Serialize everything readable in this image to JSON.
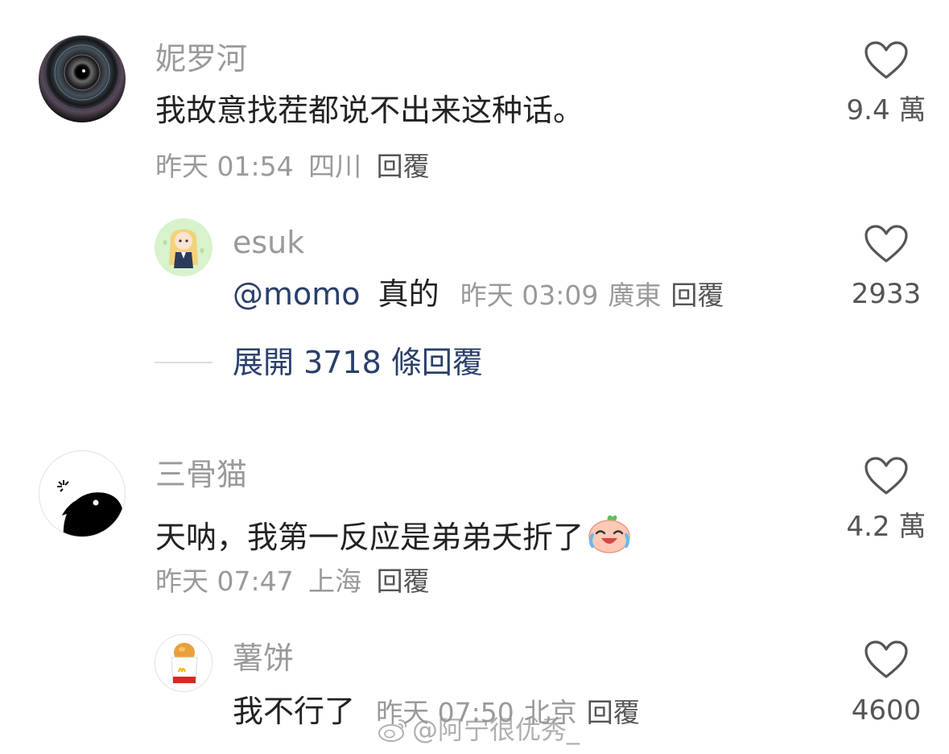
{
  "comments": [
    {
      "username": "妮罗河",
      "text": "我故意找茬都说不出来这种话。",
      "time": "昨天 01:54",
      "location": "四川",
      "reply_label": "回覆",
      "likes": "9.4 萬",
      "replies": [
        {
          "username": "esuk",
          "mention": "@momo",
          "text": "真的",
          "time": "昨天 03:09",
          "location": "廣東",
          "reply_label": "回覆",
          "likes": "2933"
        }
      ],
      "expand_label": "展開 3718 條回覆"
    },
    {
      "username": "三骨猫",
      "text": "天呐，我第一反应是弟弟夭折了",
      "time": "昨天 07:47",
      "location": "上海",
      "reply_label": "回覆",
      "likes": "4.2 萬",
      "replies": [
        {
          "username": "薯饼",
          "text": "我不行了",
          "time": "昨天 07:50",
          "location": "北京",
          "reply_label": "回覆",
          "likes": "4600"
        }
      ]
    }
  ],
  "watermark": "@阿宁很优秀_",
  "colors": {
    "username": "#9a9a9a",
    "text": "#222222",
    "link": "#2a3f6a",
    "meta": "#9a9a9a"
  }
}
